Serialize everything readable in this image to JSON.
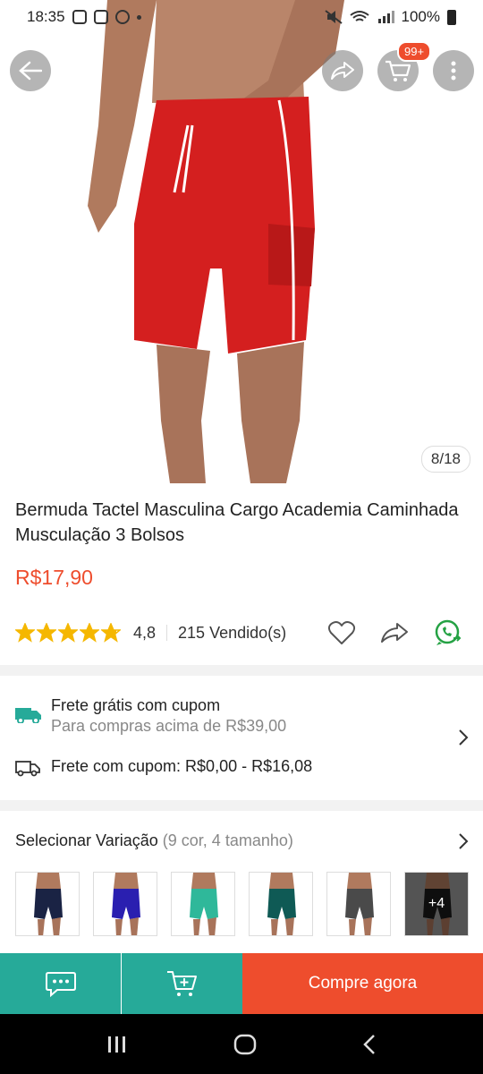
{
  "status_bar": {
    "time": "18:35",
    "battery": "100%"
  },
  "top_bar": {
    "cart_badge": "99+"
  },
  "image_counter": "8/18",
  "product": {
    "title": "Bermuda Tactel Masculina Cargo Academia Caminhada Musculação 3 Bolsos",
    "price": "R$17,90",
    "rating": 4.8,
    "rating_text": "4,8",
    "sold": "215 Vendido(s)"
  },
  "shipping": {
    "free_title": "Frete grátis com cupom",
    "free_subtitle": "Para compras acima de R$39,00",
    "coupon_range": "Frete com cupom: R$0,00 - R$16,08"
  },
  "variation": {
    "label": "Selecionar Variação",
    "detail": "(9 cor, 4 tamanho)",
    "thumbs": [
      {
        "color": "#1a2344"
      },
      {
        "color": "#2a1fb0"
      },
      {
        "color": "#2fb89a"
      },
      {
        "color": "#0f5a55"
      },
      {
        "color": "#4a4a4a"
      },
      {
        "color": "#1a1a1a"
      }
    ],
    "more_label": "+4"
  },
  "bottom_bar": {
    "buy_now": "Compre agora"
  },
  "colors": {
    "accent": "#ee4d2d",
    "teal": "#26aa99",
    "short": "#d41f1f"
  }
}
